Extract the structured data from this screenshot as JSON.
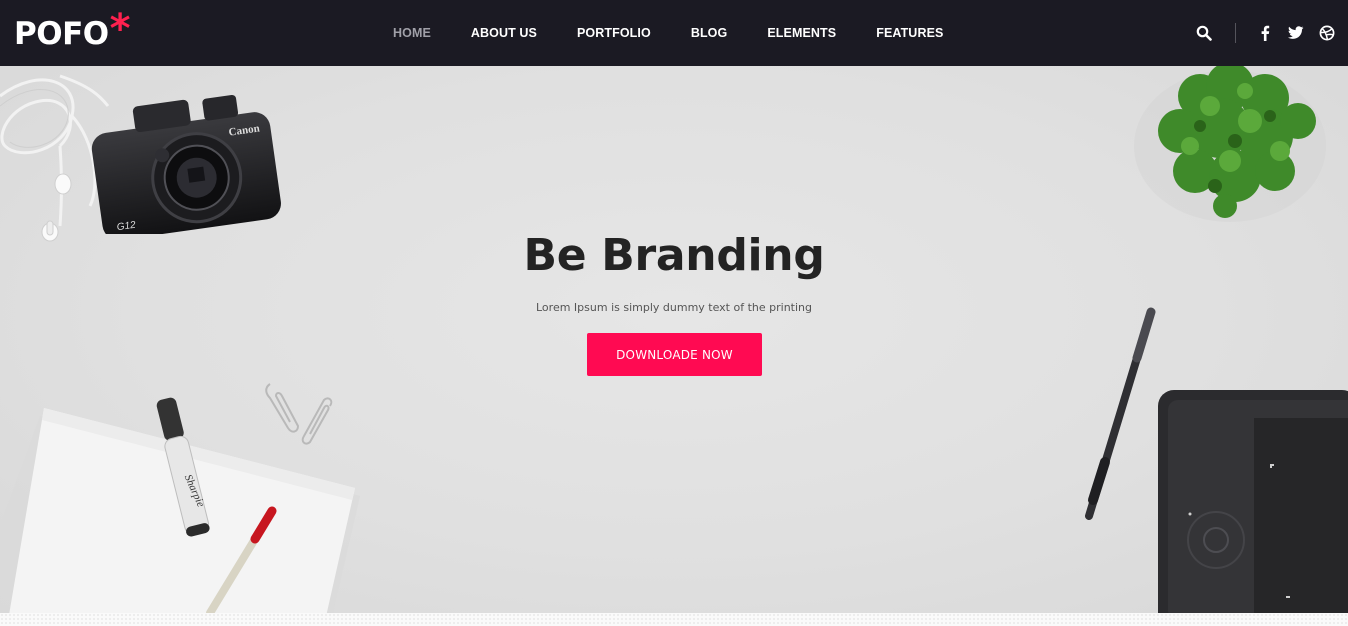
{
  "brand": {
    "logo_text": "POFO",
    "logo_mark": "*",
    "accent": "#ff214f"
  },
  "nav": {
    "items": [
      {
        "label": "HOME",
        "active": true
      },
      {
        "label": "ABOUT US",
        "active": false
      },
      {
        "label": "PORTFOLIO",
        "active": false
      },
      {
        "label": "BLOG",
        "active": false
      },
      {
        "label": "ELEMENTS",
        "active": false
      },
      {
        "label": "FEATURES",
        "active": false
      }
    ],
    "icons": [
      "search-icon",
      "facebook-icon",
      "twitter-icon",
      "dribbble-icon"
    ]
  },
  "hero": {
    "title": "Be Branding",
    "subtitle": "Lorem Ipsum is simply dummy text of the printing",
    "button_label": "DOWNLOADE NOW",
    "button_color": "#ff0a52"
  },
  "decor": {
    "camera_brand": "Canon",
    "camera_model": "G12",
    "marker_brand": "Sharpie"
  }
}
